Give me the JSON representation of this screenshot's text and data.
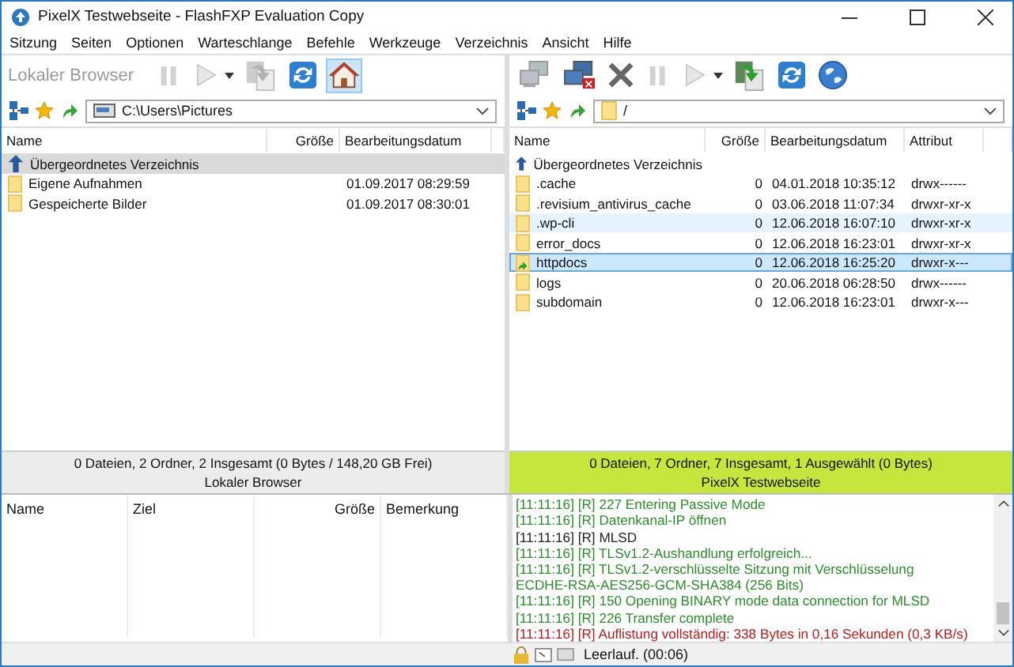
{
  "window": {
    "title": "PixelX Testwebseite - FlashFXP Evaluation Copy"
  },
  "menu": [
    "Sitzung",
    "Seiten",
    "Optionen",
    "Warteschlange",
    "Befehle",
    "Werkzeuge",
    "Verzeichnis",
    "Ansicht",
    "Hilfe"
  ],
  "panes": [
    {
      "label": "Lokaler Browser",
      "active": false,
      "toolbar": [
        {
          "kind": "pause",
          "disabled": true,
          "selected": false
        },
        {
          "kind": "play",
          "disabled": true,
          "selected": false
        },
        {
          "kind": "dropdown",
          "disabled": false,
          "selected": false
        },
        {
          "kind": "transfer",
          "disabled": true,
          "selected": false
        },
        {
          "kind": "refresh",
          "disabled": false,
          "selected": false
        },
        {
          "kind": "home",
          "disabled": false,
          "selected": true
        }
      ],
      "path": {
        "kind": "drive",
        "value": "C:\\Users\\Pictures"
      },
      "columns": [
        {
          "label": "Name",
          "kind": "name"
        },
        {
          "label": "Größe",
          "kind": "size"
        },
        {
          "label": "Bearbeitungsdatum",
          "kind": "date"
        }
      ],
      "rows": [
        {
          "kind": "parent",
          "name": "Übergeordnetes Verzeichnis",
          "selected": true,
          "highlighted": false
        },
        {
          "kind": "folder",
          "name": "Eigene Aufnahmen",
          "date": "01.09.2017 08:29:59",
          "selected": false,
          "highlighted": false
        },
        {
          "kind": "folder",
          "name": "Gespeicherte Bilder",
          "date": "01.09.2017 08:30:01",
          "selected": false,
          "highlighted": false
        }
      ],
      "status": [
        "0 Dateien, 2 Ordner, 2 Insgesamt (0 Bytes / 148,20 GB Frei)",
        "Lokaler Browser"
      ]
    },
    {
      "active": true,
      "toolbar": [
        {
          "kind": "connect",
          "disabled": true,
          "selected": false
        },
        {
          "kind": "disconnect",
          "disabled": false,
          "selected": false
        },
        {
          "kind": "abort",
          "disabled": false,
          "selected": false
        },
        {
          "kind": "pause",
          "disabled": true,
          "selected": false
        },
        {
          "kind": "play",
          "disabled": true,
          "selected": false
        },
        {
          "kind": "dropdown",
          "disabled": false,
          "selected": false
        },
        {
          "kind": "transfer",
          "disabled": false,
          "selected": false
        },
        {
          "kind": "refresh",
          "disabled": false,
          "selected": false
        },
        {
          "kind": "globe",
          "disabled": false,
          "selected": false
        }
      ],
      "path": {
        "kind": "folder",
        "value": "/"
      },
      "columns": [
        {
          "label": "Name",
          "kind": "name"
        },
        {
          "label": "Größe",
          "kind": "size"
        },
        {
          "label": "Bearbeitungsdatum",
          "kind": "date"
        },
        {
          "label": "Attribut",
          "kind": "attribute"
        }
      ],
      "rows": [
        {
          "kind": "parent",
          "name": "Übergeordnetes Verzeichnis",
          "selected": false,
          "highlighted": false
        },
        {
          "kind": "folder",
          "name": ".cache",
          "size": "0",
          "date": "04.01.2018 10:35:12",
          "attribute": "drwx------",
          "selected": false,
          "highlighted": false
        },
        {
          "kind": "folder",
          "name": ".revisium_antivirus_cache",
          "size": "0",
          "date": "03.06.2018 11:07:34",
          "attribute": "drwxr-xr-x",
          "selected": false,
          "highlighted": false
        },
        {
          "kind": "folder",
          "name": ".wp-cli",
          "size": "0",
          "date": "12.06.2018 16:07:10",
          "attribute": "drwxr-xr-x",
          "selected": false,
          "highlighted": true
        },
        {
          "kind": "folder",
          "name": "error_docs",
          "size": "0",
          "date": "12.06.2018 16:23:01",
          "attribute": "drwxr-xr-x",
          "selected": false,
          "highlighted": false
        },
        {
          "kind": "link",
          "name": "httpdocs",
          "size": "0",
          "date": "12.06.2018 16:25:20",
          "attribute": "drwxr-x---",
          "selected": true,
          "highlighted": false
        },
        {
          "kind": "folder",
          "name": "logs",
          "size": "0",
          "date": "20.06.2018 06:28:50",
          "attribute": "drwx------",
          "selected": false,
          "highlighted": false
        },
        {
          "kind": "folder",
          "name": "subdomain",
          "size": "0",
          "date": "12.06.2018 16:23:01",
          "attribute": "drwxr-x---",
          "selected": false,
          "highlighted": false
        }
      ],
      "status": [
        "0 Dateien, 7 Ordner, 7 Insgesamt, 1 Ausgewählt (0 Bytes)",
        "PixelX Testwebseite"
      ]
    }
  ],
  "queue": {
    "columns": [
      "Name",
      "Ziel",
      "Größe",
      "Bemerkung"
    ]
  },
  "log": [
    {
      "kind": "response",
      "text": "[11:11:16] [R] 227 Entering Passive Mode"
    },
    {
      "kind": "response",
      "text": "[11:11:16] [R] Datenkanal-IP öffnen"
    },
    {
      "kind": "command",
      "text": "[11:11:16] [R] MLSD"
    },
    {
      "kind": "response",
      "text": "[11:11:16] [R] TLSv1.2-Aushandlung erfolgreich..."
    },
    {
      "kind": "response",
      "text": "[11:11:16] [R] TLSv1.2-verschlüsselte Sitzung mit Verschlüsselung"
    },
    {
      "kind": "response",
      "text": "ECDHE-RSA-AES256-GCM-SHA384 (256 Bits)"
    },
    {
      "kind": "response",
      "text": "[11:11:16] [R] 150 Opening BINARY mode data connection for MLSD"
    },
    {
      "kind": "response",
      "text": "[11:11:16] [R] 226 Transfer complete"
    },
    {
      "kind": "error",
      "text": "[11:11:16] [R] Auflistung vollständig: 338 Bytes in 0,16 Sekunden (0,3 KB/s)"
    }
  ],
  "status_bar": {
    "text": "Leerlauf. (00:06)"
  }
}
